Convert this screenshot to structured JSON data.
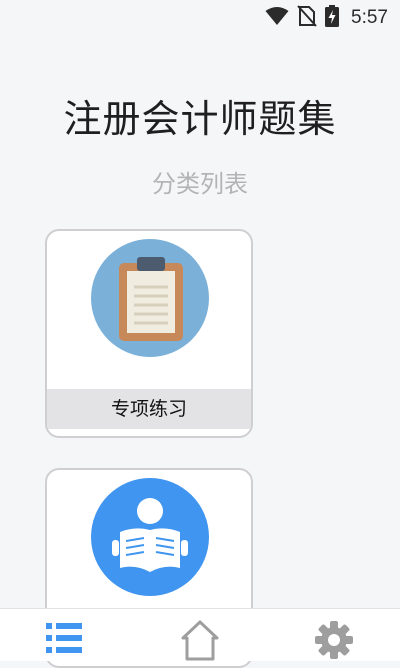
{
  "status_bar": {
    "time": "5:57",
    "icons": [
      "wifi-icon",
      "no-sim-icon",
      "battery-charging-icon"
    ]
  },
  "app": {
    "title": "注册会计师题集",
    "subtitle": "分类列表"
  },
  "categories": [
    {
      "label": "专项练习",
      "icon": "clipboard-icon",
      "color": "#7bb1d9"
    },
    {
      "label": "",
      "icon": "reader-icon",
      "color": "#3f95ef"
    }
  ],
  "tabbar": {
    "tabs": [
      {
        "icon": "list-icon",
        "active": true,
        "color": "#3f95ef"
      },
      {
        "icon": "home-icon",
        "active": false,
        "color": "#9e9e9e"
      },
      {
        "icon": "gear-icon",
        "active": false,
        "color": "#9e9e9e"
      }
    ]
  }
}
